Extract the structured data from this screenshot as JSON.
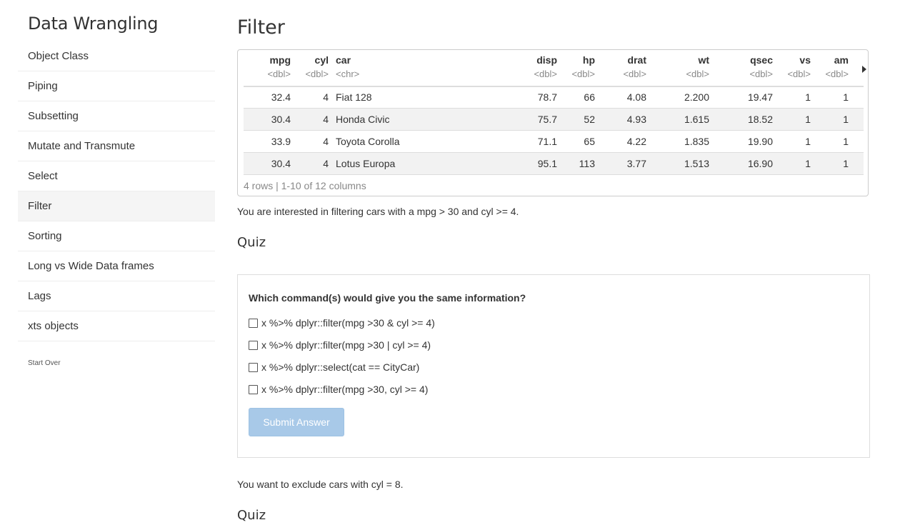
{
  "sidebar": {
    "title": "Data Wrangling",
    "items": [
      {
        "label": "Object Class"
      },
      {
        "label": "Piping"
      },
      {
        "label": "Subsetting"
      },
      {
        "label": "Mutate and Transmute"
      },
      {
        "label": "Select"
      },
      {
        "label": "Filter",
        "active": true
      },
      {
        "label": "Sorting"
      },
      {
        "label": "Long vs Wide Data frames"
      },
      {
        "label": "Lags"
      },
      {
        "label": "xts objects"
      }
    ],
    "start_over": "Start Over"
  },
  "main": {
    "title": "Filter",
    "table": {
      "columns": [
        {
          "name": "mpg",
          "type": "<dbl>"
        },
        {
          "name": "cyl",
          "type": "<dbl>"
        },
        {
          "name": "car",
          "type": "<chr>"
        },
        {
          "name": "disp",
          "type": "<dbl>"
        },
        {
          "name": "hp",
          "type": "<dbl>"
        },
        {
          "name": "drat",
          "type": "<dbl>"
        },
        {
          "name": "wt",
          "type": "<dbl>"
        },
        {
          "name": "qsec",
          "type": "<dbl>"
        },
        {
          "name": "vs",
          "type": "<dbl>"
        },
        {
          "name": "am",
          "type": "<dbl>"
        }
      ],
      "rows": [
        [
          "32.4",
          "4",
          "Fiat 128",
          "78.7",
          "66",
          "4.08",
          "2.200",
          "19.47",
          "1",
          "1"
        ],
        [
          "30.4",
          "4",
          "Honda Civic",
          "75.7",
          "52",
          "4.93",
          "1.615",
          "18.52",
          "1",
          "1"
        ],
        [
          "33.9",
          "4",
          "Toyota Corolla",
          "71.1",
          "65",
          "4.22",
          "1.835",
          "19.90",
          "1",
          "1"
        ],
        [
          "30.4",
          "4",
          "Lotus Europa",
          "95.1",
          "113",
          "3.77",
          "1.513",
          "16.90",
          "1",
          "1"
        ]
      ],
      "footer": "4 rows | 1-10 of 12 columns",
      "scroll_icon": "triangle-right-icon"
    },
    "intro1": "You are interested in filtering cars with a mpg > 30 and cyl >= 4.",
    "quiz_heading": "Quiz",
    "quiz": {
      "question": "Which command(s) would give you the same information?",
      "options": [
        "x %>% dplyr::filter(mpg >30 & cyl >= 4)",
        "x %>% dplyr::filter(mpg >30 | cyl >= 4)",
        "x %>% dplyr::select(cat == CityCar)",
        "x %>% dplyr::filter(mpg >30, cyl >= 4)"
      ],
      "submit_label": "Submit Answer",
      "submit_color": "#a8c9e8"
    },
    "intro2": "You want to exclude cars with cyl = 8.",
    "quiz2_heading": "Quiz"
  }
}
